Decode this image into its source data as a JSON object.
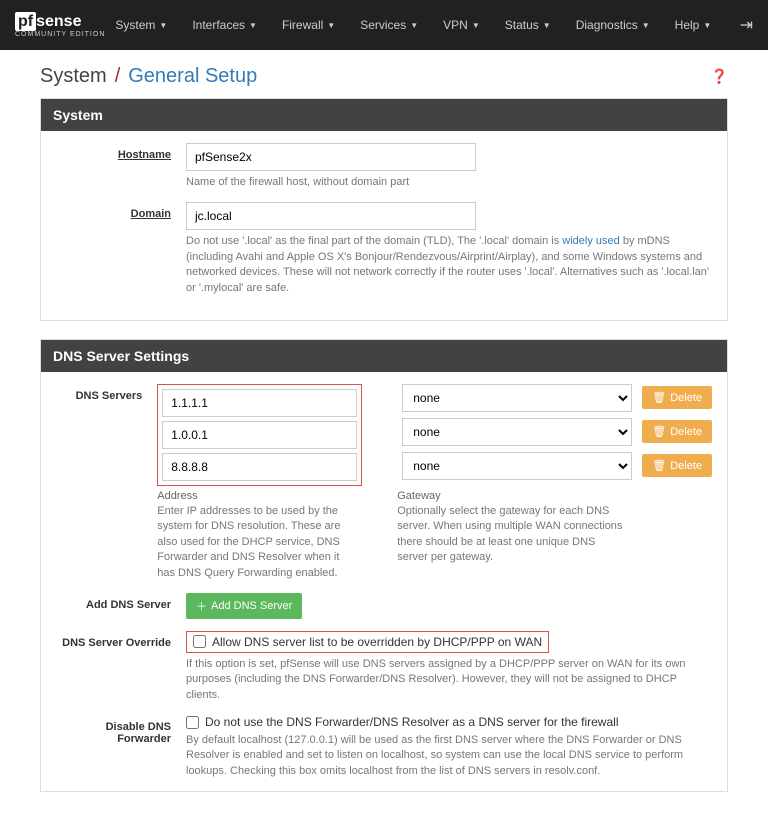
{
  "brand": {
    "name": "pfsense",
    "edition": "COMMUNITY EDITION"
  },
  "nav": {
    "items": [
      "System",
      "Interfaces",
      "Firewall",
      "Services",
      "VPN",
      "Status",
      "Diagnostics",
      "Help"
    ]
  },
  "breadcrumb": {
    "root": "System",
    "page": "General Setup"
  },
  "panels": {
    "system": {
      "title": "System",
      "hostname": {
        "label": "Hostname",
        "value": "pfSense2x",
        "help": "Name of the firewall host, without domain part"
      },
      "domain": {
        "label": "Domain",
        "value": "jc.local",
        "help1": "Do not use '.local' as the final part of the domain (TLD), The '.local' domain is ",
        "link": "widely used",
        "help2": " by mDNS (including Avahi and Apple OS X's Bonjour/Rendezvous/Airprint/Airplay), and some Windows systems and networked devices. These will not network correctly if the router uses '.local'. Alternatives such as '.local.lan' or '.mylocal' are safe."
      }
    },
    "dns": {
      "title": "DNS Server Settings",
      "servers_label": "DNS Servers",
      "servers": [
        {
          "ip": "1.1.1.1",
          "gw": "none"
        },
        {
          "ip": "1.0.0.1",
          "gw": "none"
        },
        {
          "ip": "8.8.8.8",
          "gw": "none"
        }
      ],
      "delete_label": "Delete",
      "address_col": {
        "title": "Address",
        "help": "Enter IP addresses to be used by the system for DNS resolution. These are also used for the DHCP service, DNS Forwarder and DNS Resolver when it has DNS Query Forwarding enabled."
      },
      "gateway_col": {
        "title": "Gateway",
        "help": "Optionally select the gateway for each DNS server. When using multiple WAN connections there should be at least one unique DNS server per gateway."
      },
      "add": {
        "label": "Add DNS Server",
        "button": "Add DNS Server"
      },
      "override": {
        "label": "DNS Server Override",
        "checkbox": "Allow DNS server list to be overridden by DHCP/PPP on WAN",
        "help": "If this option is set, pfSense will use DNS servers assigned by a DHCP/PPP server on WAN for its own purposes (including the DNS Forwarder/DNS Resolver). However, they will not be assigned to DHCP clients."
      },
      "disable_forwarder": {
        "label": "Disable DNS Forwarder",
        "checkbox": "Do not use the DNS Forwarder/DNS Resolver as a DNS server for the firewall",
        "help": "By default localhost (127.0.0.1) will be used as the first DNS server where the DNS Forwarder or DNS Resolver is enabled and set to listen on localhost, so system can use the local DNS service to perform lookups. Checking this box omits localhost from the list of DNS servers in resolv.conf."
      }
    }
  }
}
